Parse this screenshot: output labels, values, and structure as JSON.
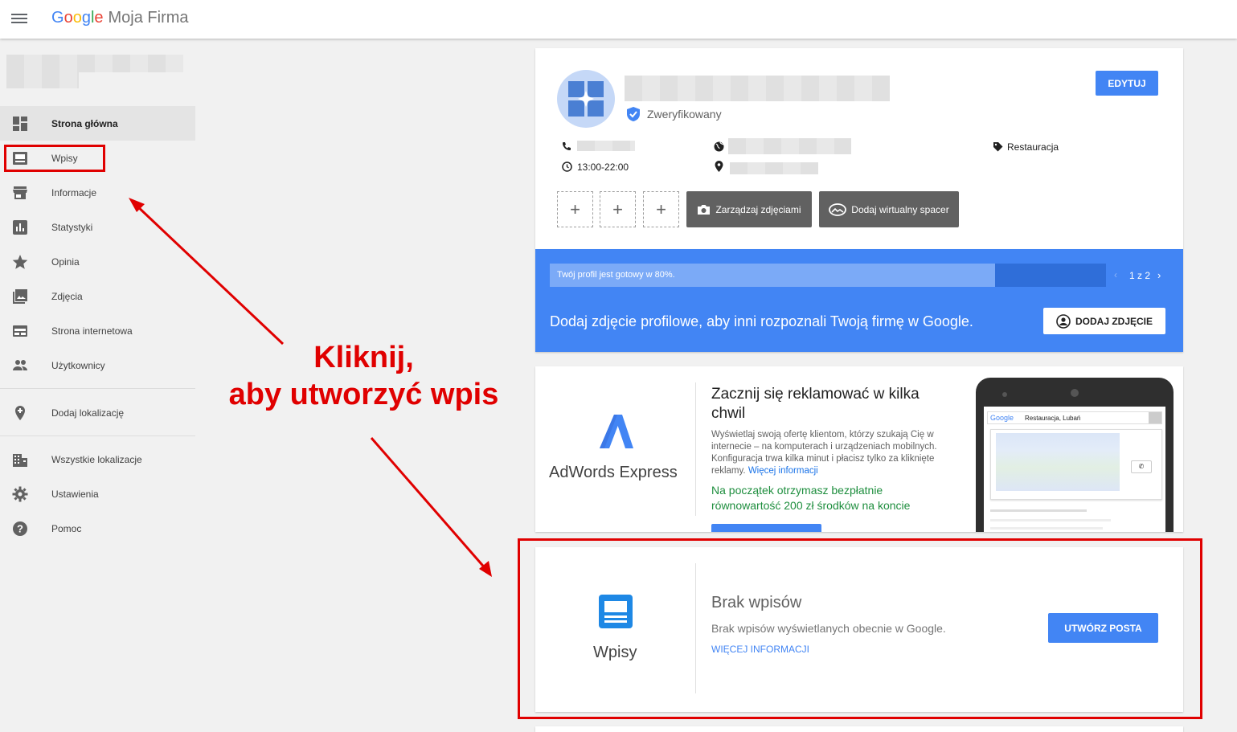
{
  "header": {
    "brand_letters": [
      "G",
      "o",
      "o",
      "g",
      "l",
      "e"
    ],
    "product": "Moja Firma"
  },
  "sidebar": {
    "items": [
      {
        "label": "Strona główna",
        "icon": "dashboard-icon"
      },
      {
        "label": "Wpisy",
        "icon": "posts-icon"
      },
      {
        "label": "Informacje",
        "icon": "store-icon"
      },
      {
        "label": "Statystyki",
        "icon": "chart-icon"
      },
      {
        "label": "Opinia",
        "icon": "star-icon"
      },
      {
        "label": "Zdjęcia",
        "icon": "photo-icon"
      },
      {
        "label": "Strona internetowa",
        "icon": "website-icon"
      },
      {
        "label": "Użytkownicy",
        "icon": "people-icon"
      },
      {
        "label": "Dodaj lokalizację",
        "icon": "add-location-icon"
      },
      {
        "label": "Wszystkie lokalizacje",
        "icon": "building-icon"
      },
      {
        "label": "Ustawienia",
        "icon": "gear-icon"
      },
      {
        "label": "Pomoc",
        "icon": "help-icon"
      }
    ]
  },
  "profile": {
    "verified": "Zweryfikowany",
    "edit_label": "EDYTUJ",
    "hours": "13:00-22:00",
    "category": "Restauracja",
    "plus": "+",
    "manage_photos": "Zarządzaj zdjęciami",
    "virtual_tour": "Dodaj wirtualny spacer"
  },
  "progress": {
    "text": "Twój profil jest gotowy w 80%.",
    "percent": 80,
    "pager": "1 z 2",
    "prompt": "Dodaj zdjęcie profilowe, aby inni rozpoznali Twoją firmę w Google.",
    "button": "DODAJ ZDJĘCIE"
  },
  "adwords": {
    "brand": "AdWords Express",
    "title": "Zacznij się reklamować w kilka chwil",
    "body": "Wyświetlaj swoją ofertę klientom, którzy szukają Cię w internecie – na komputerach i urządzeniach mobilnych. Konfiguracja trwa kilka minut i płacisz tylko za kliknięte reklamy.",
    "more": "Więcej informacji",
    "promo": "Na początek otrzymasz bezpłatnie równowartość 200 zł środków na koncie",
    "phone_search": "Restauracja, Lubań",
    "phone_google": "Google"
  },
  "posts": {
    "label": "Wpisy",
    "title": "Brak wpisów",
    "body": "Brak wpisów wyświetlanych obecnie w Google.",
    "more": "WIĘCEJ INFORMACJI",
    "button": "UTWÓRZ POSTA"
  },
  "annotation": {
    "line1": "Kliknij,",
    "line2": "aby utworzyć wpis"
  },
  "colors": {
    "accent": "#4285f4",
    "annotation": "#e00000",
    "promo_green": "#1e8e3e"
  }
}
